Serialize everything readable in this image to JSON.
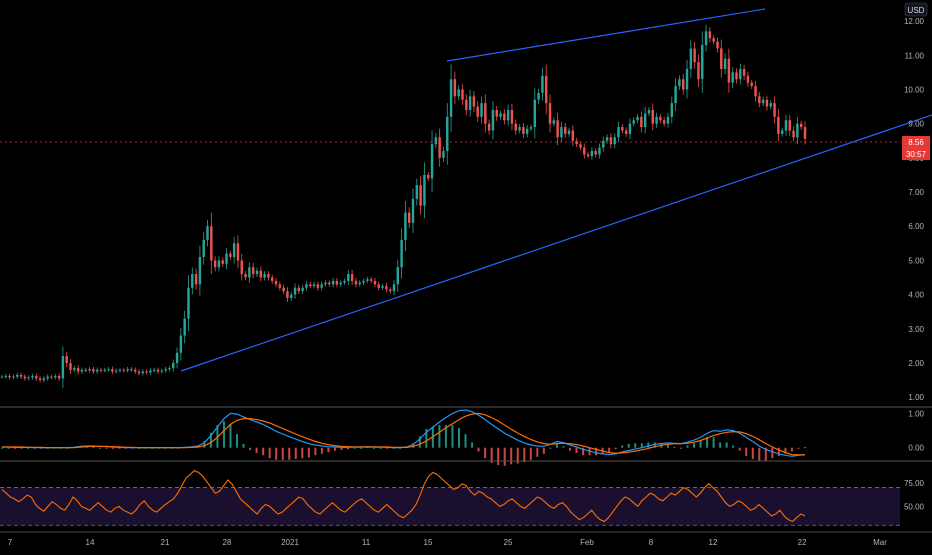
{
  "currency_label": "USD",
  "current_price_label": "8.56",
  "countdown_label": "30:57",
  "colors": {
    "background": "#000000",
    "up": "#26a69a",
    "down": "#ef5350",
    "trendline": "#2962ff",
    "macd_line": "#2196f3",
    "signal_line": "#ff6d00",
    "rsi_line": "#ff6d00",
    "rsi_band": "#1a0f2e",
    "price_badge": "#e53935",
    "axis_text": "#b2b5be",
    "grid_separator": "#555555"
  },
  "chart_data": [
    {
      "type": "candlestick",
      "pane": "price",
      "currency": "USD",
      "ylim": [
        0.8,
        12.5
      ],
      "y_ticks": [
        "12.00",
        "11.00",
        "10.00",
        "9.00",
        "8.00",
        "7.00",
        "6.00",
        "5.00",
        "4.00",
        "3.00",
        "2.00",
        "1.00"
      ],
      "x_ticks": [
        "7",
        "14",
        "21",
        "28",
        "2021",
        "11",
        "15",
        "25",
        "Feb",
        "8",
        "12",
        "22",
        "Mar"
      ],
      "last_price": 8.56,
      "ohlc_close": [
        1.6,
        1.62,
        1.58,
        1.6,
        1.65,
        1.6,
        1.55,
        1.58,
        1.62,
        1.55,
        1.5,
        1.55,
        1.6,
        1.58,
        1.62,
        1.55,
        2.2,
        2.0,
        1.8,
        1.85,
        1.75,
        1.8,
        1.78,
        1.82,
        1.75,
        1.8,
        1.78,
        1.8,
        1.82,
        1.75,
        1.78,
        1.8,
        1.78,
        1.82,
        1.8,
        1.75,
        1.7,
        1.75,
        1.72,
        1.78,
        1.8,
        1.75,
        1.78,
        1.82,
        1.85,
        2.0,
        2.3,
        2.8,
        3.3,
        4.2,
        4.6,
        4.3,
        5.1,
        5.6,
        6.0,
        5.0,
        4.8,
        5.0,
        4.9,
        5.2,
        5.1,
        5.5,
        5.0,
        4.6,
        4.5,
        4.8,
        4.6,
        4.7,
        4.5,
        4.6,
        4.5,
        4.4,
        4.3,
        4.2,
        4.1,
        3.9,
        4.0,
        4.2,
        4.1,
        4.2,
        4.3,
        4.25,
        4.3,
        4.2,
        4.3,
        4.35,
        4.3,
        4.4,
        4.3,
        4.35,
        4.4,
        4.6,
        4.4,
        4.3,
        4.35,
        4.4,
        4.45,
        4.4,
        4.3,
        4.2,
        4.25,
        4.15,
        4.1,
        4.3,
        4.8,
        5.6,
        6.4,
        6.1,
        6.8,
        7.2,
        6.6,
        7.5,
        7.4,
        8.4,
        8.6,
        8.0,
        8.2,
        9.2,
        10.3,
        9.8,
        10.0,
        9.7,
        9.4,
        9.8,
        9.5,
        9.2,
        9.6,
        9.0,
        8.8,
        9.4,
        9.2,
        9.3,
        9.1,
        9.4,
        9.0,
        8.8,
        8.9,
        8.7,
        8.85,
        8.9,
        9.7,
        9.9,
        10.4,
        9.6,
        9.0,
        9.1,
        8.6,
        8.9,
        8.7,
        8.8,
        8.5,
        8.4,
        8.3,
        8.1,
        8.05,
        8.2,
        8.1,
        8.3,
        8.5,
        8.6,
        8.4,
        8.6,
        8.9,
        8.8,
        8.7,
        9.0,
        9.1,
        9.2,
        8.9,
        9.3,
        9.4,
        9.0,
        9.2,
        9.1,
        9.0,
        9.2,
        9.6,
        10.1,
        10.3,
        10.0,
        10.6,
        11.2,
        10.8,
        10.3,
        11.3,
        11.7,
        11.5,
        11.4,
        11.2,
        10.6,
        10.9,
        10.2,
        10.5,
        10.3,
        10.6,
        10.4,
        10.2,
        10.1,
        9.8,
        9.6,
        9.7,
        9.5,
        9.6,
        9.2,
        8.7,
        8.8,
        9.1,
        8.8,
        8.6,
        9.0,
        8.9,
        8.56
      ]
    },
    {
      "type": "line",
      "pane": "macd",
      "ylim": [
        -0.3,
        1.1
      ],
      "y_ticks": [
        "1.00",
        "0.00"
      ],
      "series": [
        {
          "values": [
            0.02,
            0.02,
            0.01,
            0.01,
            0.01,
            0.0,
            0.0,
            0.0,
            0.0,
            0.0,
            0.0,
            0.01,
            0.04,
            0.05,
            0.05,
            0.04,
            0.03,
            0.02,
            0.01,
            0.0,
            0.0,
            0.0,
            0.0,
            0.0,
            0.0,
            0.0,
            0.0,
            0.0,
            0.01,
            0.02,
            0.05,
            0.15,
            0.35,
            0.6,
            0.85,
            1.0,
            0.98,
            0.9,
            0.82,
            0.75,
            0.68,
            0.58,
            0.48,
            0.4,
            0.32,
            0.25,
            0.18,
            0.12,
            0.08,
            0.05,
            0.03,
            0.02,
            0.01,
            0.01,
            0.02,
            0.02,
            0.03,
            0.02,
            0.02,
            0.01,
            0.0,
            0.0,
            0.02,
            0.1,
            0.25,
            0.45,
            0.6,
            0.75,
            0.88,
            1.0,
            1.08,
            1.1,
            1.05,
            0.95,
            0.82,
            0.68,
            0.55,
            0.42,
            0.32,
            0.22,
            0.14,
            0.08,
            0.05,
            0.04,
            0.1,
            0.18,
            0.15,
            0.08,
            0.02,
            -0.05,
            -0.1,
            -0.15,
            -0.18,
            -0.2,
            -0.18,
            -0.12,
            -0.08,
            -0.04,
            0.0,
            0.05,
            0.1,
            0.12,
            0.14,
            0.13,
            0.12,
            0.16,
            0.22,
            0.3,
            0.42,
            0.5,
            0.48,
            0.52,
            0.5,
            0.42,
            0.3,
            0.18,
            0.05,
            -0.05,
            -0.12,
            -0.18,
            -0.22,
            -0.25,
            -0.22,
            -0.2
          ]
        },
        {
          "values": [
            0.02,
            0.02,
            0.02,
            0.02,
            0.01,
            0.01,
            0.01,
            0.0,
            0.0,
            0.0,
            0.0,
            0.0,
            0.02,
            0.03,
            0.04,
            0.04,
            0.04,
            0.03,
            0.02,
            0.01,
            0.01,
            0.0,
            0.0,
            0.0,
            0.0,
            0.0,
            0.0,
            0.0,
            0.0,
            0.01,
            0.02,
            0.06,
            0.15,
            0.3,
            0.5,
            0.68,
            0.8,
            0.85,
            0.85,
            0.82,
            0.78,
            0.72,
            0.64,
            0.56,
            0.48,
            0.4,
            0.32,
            0.25,
            0.18,
            0.13,
            0.09,
            0.06,
            0.04,
            0.03,
            0.02,
            0.02,
            0.02,
            0.02,
            0.02,
            0.02,
            0.01,
            0.01,
            0.01,
            0.04,
            0.1,
            0.2,
            0.32,
            0.45,
            0.58,
            0.7,
            0.82,
            0.92,
            0.98,
            1.0,
            0.96,
            0.88,
            0.78,
            0.66,
            0.54,
            0.43,
            0.33,
            0.24,
            0.17,
            0.12,
            0.1,
            0.12,
            0.13,
            0.12,
            0.09,
            0.05,
            0.0,
            -0.05,
            -0.1,
            -0.14,
            -0.16,
            -0.15,
            -0.13,
            -0.1,
            -0.06,
            -0.02,
            0.03,
            0.07,
            0.1,
            0.12,
            0.12,
            0.13,
            0.16,
            0.21,
            0.28,
            0.36,
            0.41,
            0.45,
            0.47,
            0.46,
            0.41,
            0.33,
            0.23,
            0.12,
            0.02,
            -0.07,
            -0.14,
            -0.2,
            -0.21,
            -0.21
          ]
        }
      ]
    },
    {
      "type": "line",
      "pane": "rsi",
      "ylim": [
        25,
        95
      ],
      "y_ticks": [
        "75.00",
        "50.00"
      ],
      "levels": [
        70,
        30
      ],
      "series": [
        {
          "values": [
            68,
            64,
            60,
            58,
            55,
            58,
            62,
            60,
            52,
            48,
            45,
            50,
            55,
            52,
            48,
            46,
            52,
            60,
            56,
            50,
            48,
            46,
            50,
            54,
            50,
            46,
            44,
            48,
            50,
            46,
            44,
            42,
            46,
            52,
            56,
            50,
            46,
            44,
            48,
            52,
            55,
            58,
            64,
            72,
            80,
            84,
            88,
            86,
            82,
            76,
            70,
            64,
            66,
            72,
            78,
            74,
            66,
            58,
            54,
            50,
            46,
            42,
            48,
            52,
            50,
            46,
            42,
            44,
            48,
            52,
            56,
            60,
            58,
            52,
            48,
            44,
            42,
            46,
            50,
            54,
            50,
            46,
            44,
            48,
            52,
            56,
            58,
            54,
            50,
            46,
            44,
            48,
            52,
            48,
            44,
            40,
            38,
            42,
            46,
            52,
            62,
            74,
            82,
            86,
            84,
            80,
            76,
            72,
            68,
            70,
            74,
            72,
            66,
            62,
            66,
            64,
            60,
            58,
            54,
            50,
            52,
            56,
            58,
            54,
            50,
            48,
            52,
            56,
            60,
            58,
            54,
            50,
            48,
            52,
            54,
            50,
            44,
            40,
            36,
            38,
            42,
            46,
            40,
            36,
            34,
            38,
            44,
            50,
            56,
            60,
            58,
            54,
            50,
            56,
            60,
            64,
            62,
            58,
            56,
            60,
            64,
            62,
            66,
            70,
            68,
            64,
            60,
            64,
            70,
            74,
            70,
            66,
            60,
            54,
            50,
            52,
            56,
            54,
            50,
            46,
            48,
            52,
            48,
            44,
            40,
            42,
            46,
            40,
            36,
            34,
            38,
            42,
            40
          ]
        }
      ]
    }
  ]
}
